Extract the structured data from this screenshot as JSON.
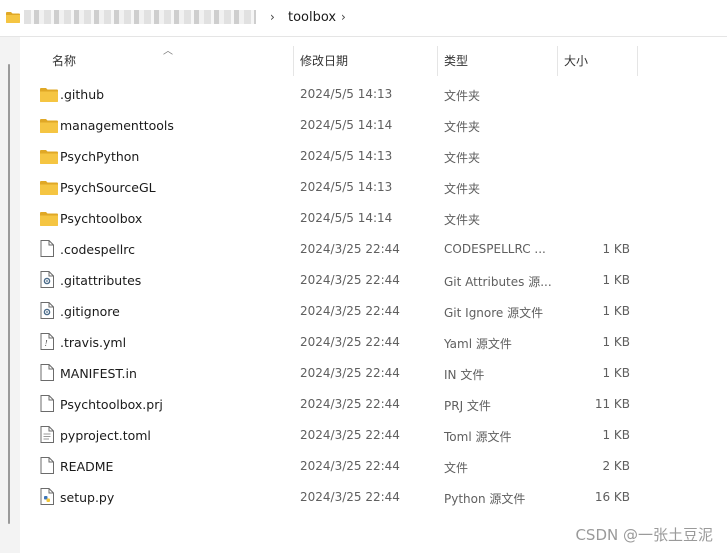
{
  "address": {
    "crumb": "toolbox",
    "chevron": "›"
  },
  "columns": {
    "name": "名称",
    "modified": "修改日期",
    "type": "类型",
    "size": "大小"
  },
  "files": [
    {
      "name": ".github",
      "date": "2024/5/5 14:13",
      "type": "文件夹",
      "size": "",
      "icon": "folder-icon"
    },
    {
      "name": "managementtools",
      "date": "2024/5/5 14:14",
      "type": "文件夹",
      "size": "",
      "icon": "folder-icon"
    },
    {
      "name": "PsychPython",
      "date": "2024/5/5 14:13",
      "type": "文件夹",
      "size": "",
      "icon": "folder-icon"
    },
    {
      "name": "PsychSourceGL",
      "date": "2024/5/5 14:13",
      "type": "文件夹",
      "size": "",
      "icon": "folder-icon"
    },
    {
      "name": "Psychtoolbox",
      "date": "2024/5/5 14:14",
      "type": "文件夹",
      "size": "",
      "icon": "folder-icon"
    },
    {
      "name": ".codespellrc",
      "date": "2024/3/25 22:44",
      "type": "CODESPELLRC ...",
      "size": "1 KB",
      "icon": "file-icon"
    },
    {
      "name": ".gitattributes",
      "date": "2024/3/25 22:44",
      "type": "Git Attributes 源...",
      "size": "1 KB",
      "icon": "config-file-icon"
    },
    {
      "name": ".gitignore",
      "date": "2024/3/25 22:44",
      "type": "Git Ignore 源文件",
      "size": "1 KB",
      "icon": "config-file-icon"
    },
    {
      "name": ".travis.yml",
      "date": "2024/3/25 22:44",
      "type": "Yaml 源文件",
      "size": "1 KB",
      "icon": "yaml-file-icon"
    },
    {
      "name": "MANIFEST.in",
      "date": "2024/3/25 22:44",
      "type": "IN 文件",
      "size": "1 KB",
      "icon": "file-icon"
    },
    {
      "name": "Psychtoolbox.prj",
      "date": "2024/3/25 22:44",
      "type": "PRJ 文件",
      "size": "11 KB",
      "icon": "file-icon"
    },
    {
      "name": "pyproject.toml",
      "date": "2024/3/25 22:44",
      "type": "Toml 源文件",
      "size": "1 KB",
      "icon": "text-file-icon"
    },
    {
      "name": "README",
      "date": "2024/3/25 22:44",
      "type": "文件",
      "size": "2 KB",
      "icon": "file-icon"
    },
    {
      "name": "setup.py",
      "date": "2024/3/25 22:44",
      "type": "Python 源文件",
      "size": "16 KB",
      "icon": "python-file-icon"
    }
  ],
  "watermark": "CSDN @一张土豆泥",
  "colors": {
    "folder": "#f5c542",
    "folderDark": "#e0a826",
    "selection": "#cce8ff"
  }
}
